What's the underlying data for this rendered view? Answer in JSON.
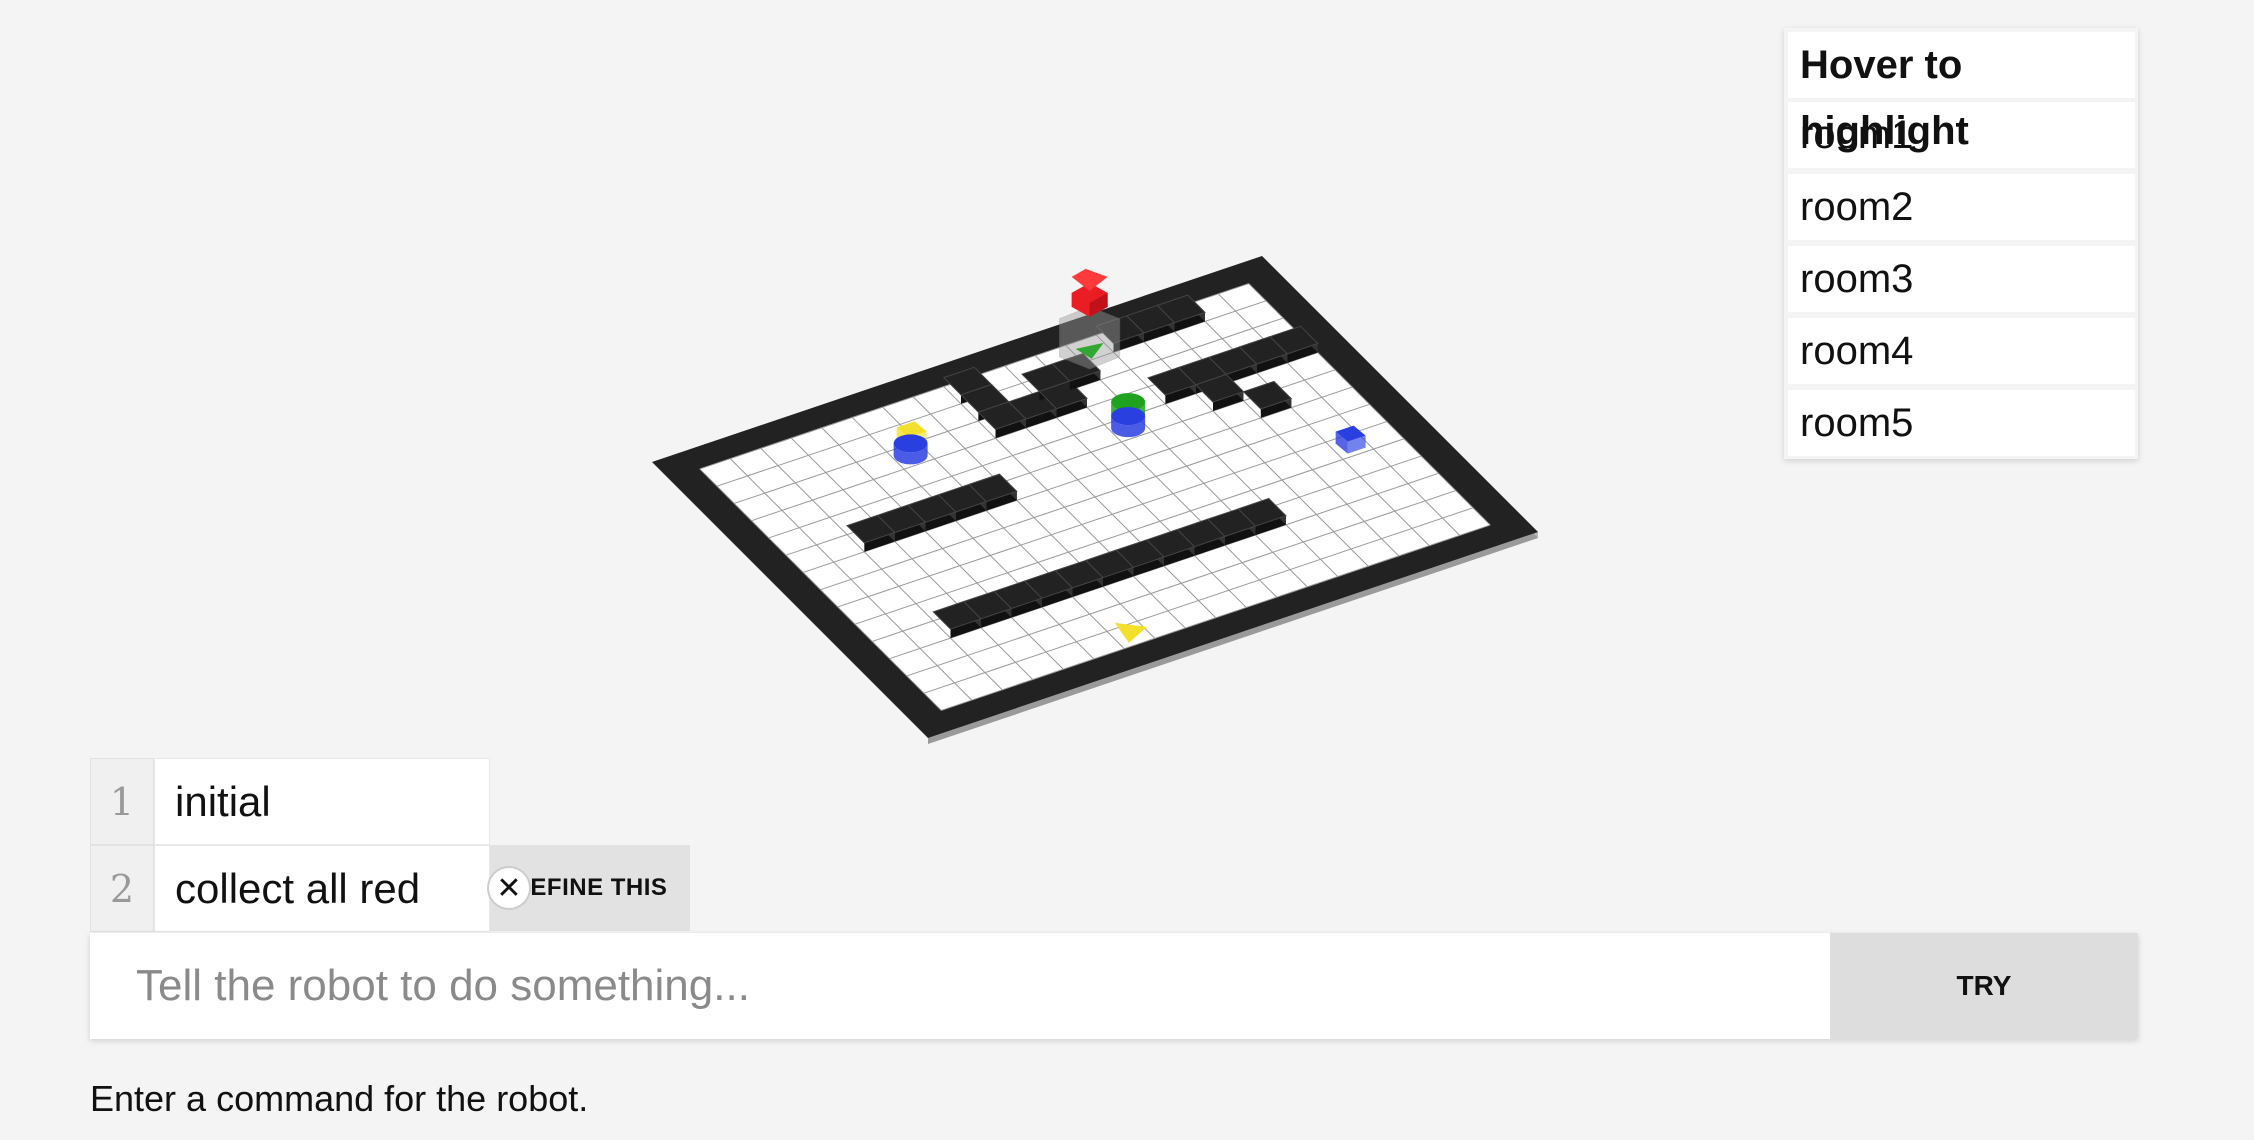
{
  "highlight_panel": {
    "title": "Hover to highlight",
    "rooms": [
      "room1",
      "room2",
      "room3",
      "room4",
      "room5"
    ]
  },
  "history": [
    {
      "num": "1",
      "text": "initial"
    },
    {
      "num": "2",
      "text": "collect all red"
    }
  ],
  "buttons": {
    "clear_symbol": "✕",
    "define_label": "DEFINE THIS",
    "try_label": "TRY"
  },
  "command": {
    "placeholder": "Tell the robot to do something..."
  },
  "status_text": "Enter a command for the robot.",
  "colors": {
    "background": "#f4f4f4",
    "wall": "#222222",
    "floor": "#ffffff",
    "grid": "#999999",
    "yellow": "#f2e02a",
    "blue": "#2a3fe0",
    "green": "#1fa31f",
    "red": "#ea1c24"
  },
  "world": {
    "cols": 20,
    "rows": 16,
    "walls": [
      [
        9,
        1
      ],
      [
        9,
        2
      ],
      [
        9,
        3
      ],
      [
        10,
        3
      ],
      [
        11,
        3
      ],
      [
        11,
        2
      ],
      [
        12,
        2
      ],
      [
        3,
        6
      ],
      [
        4,
        6
      ],
      [
        5,
        6
      ],
      [
        6,
        6
      ],
      [
        7,
        6
      ],
      [
        14,
        1
      ],
      [
        15,
        1
      ],
      [
        16,
        1
      ],
      [
        14,
        4
      ],
      [
        15,
        4
      ],
      [
        16,
        4
      ],
      [
        17,
        4
      ],
      [
        18,
        4
      ],
      [
        15,
        5
      ],
      [
        16,
        6
      ],
      [
        3,
        11
      ],
      [
        4,
        11
      ],
      [
        5,
        11
      ],
      [
        6,
        11
      ],
      [
        7,
        11
      ],
      [
        8,
        11
      ],
      [
        9,
        11
      ],
      [
        10,
        11
      ],
      [
        11,
        11
      ],
      [
        12,
        11
      ],
      [
        13,
        11
      ]
    ],
    "objects": [
      {
        "type": "block",
        "color": "yellow",
        "col": 6,
        "row": 3
      },
      {
        "type": "cylinder",
        "color": "blue",
        "col": 6,
        "row": 3
      },
      {
        "type": "cylinder",
        "color": "green",
        "col": 12,
        "row": 5
      },
      {
        "type": "cylinder",
        "color": "blue",
        "col": 12,
        "row": 5
      },
      {
        "type": "block",
        "color": "blue",
        "col": 17,
        "row": 9
      },
      {
        "type": "triangle",
        "color": "yellow",
        "col": 7,
        "row": 14
      },
      {
        "type": "robot",
        "color": "red",
        "col": 13,
        "row": 1
      }
    ]
  }
}
